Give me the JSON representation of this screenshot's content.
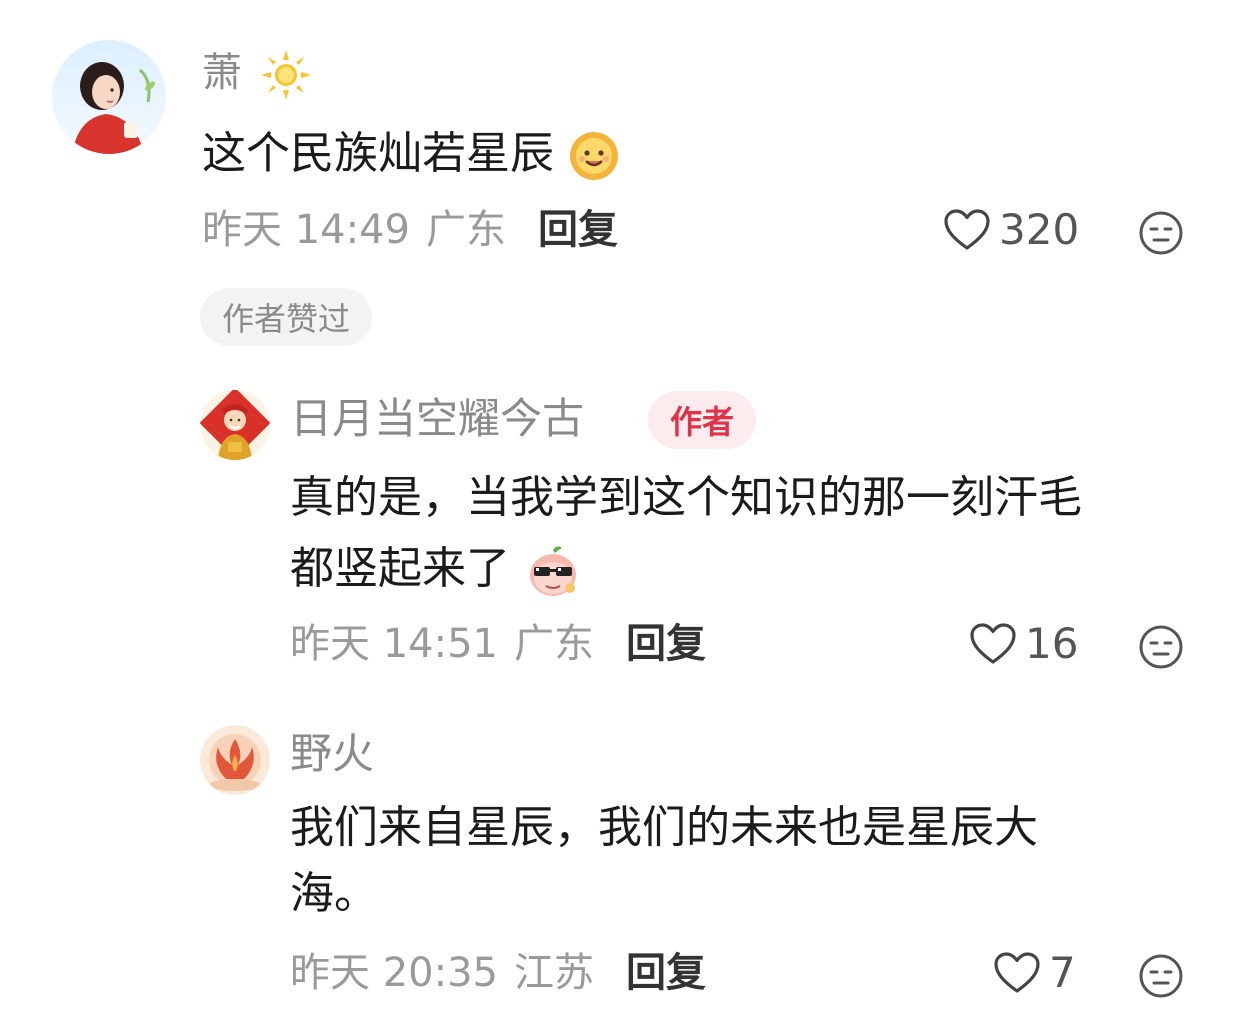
{
  "comments": [
    {
      "username": "萧",
      "username_icon": "sun-icon",
      "content_lines": [
        "这个民族灿若星辰"
      ],
      "content_emoji": "smiling-sun-emoji",
      "time": "昨天 14:49",
      "location": "广东",
      "reply_label": "回复",
      "likes": "320",
      "badge": "作者赞过"
    },
    {
      "username": "日月当空耀今古",
      "author_tag": "作者",
      "content_lines": [
        "真的是，当我学到这个知识的那一刻汗毛",
        "都竖起来了"
      ],
      "content_emoji": "cool-peach-emoji",
      "time": "昨天 14:51",
      "location": "广东",
      "reply_label": "回复",
      "likes": "16"
    },
    {
      "username": "野火",
      "content_lines": [
        "我们来自星辰，我们的未来也是星辰大",
        "海。"
      ],
      "time": "昨天 20:35",
      "location": "江苏",
      "reply_label": "回复",
      "likes": "7"
    }
  ],
  "colors": {
    "meta_text": "#9a9a9a",
    "author_tag_bg": "#fdecee",
    "author_tag_text": "#e0334a",
    "badge_bg": "#f3f3f3"
  }
}
